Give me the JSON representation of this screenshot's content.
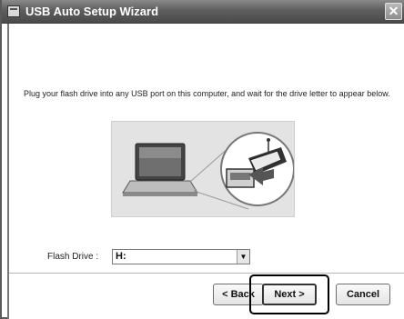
{
  "window": {
    "title": "USB Auto Setup Wizard",
    "close_glyph": "✕"
  },
  "content": {
    "instruction": "Plug your flash drive into any USB port on this computer, and wait for the drive letter to appear below."
  },
  "drive_selector": {
    "label": "Flash Drive :",
    "value": "H:",
    "dropdown_glyph": "▼"
  },
  "buttons": {
    "back": "< Back",
    "next": "Next >",
    "cancel": "Cancel"
  },
  "icons": {
    "app": "wizard-app-icon",
    "illustration": "laptop-usb-plug-illustration"
  },
  "colors": {
    "titlebar": "#5e5e5e",
    "illustration_bg": "#e3e3e3",
    "highlight": "#000000"
  }
}
